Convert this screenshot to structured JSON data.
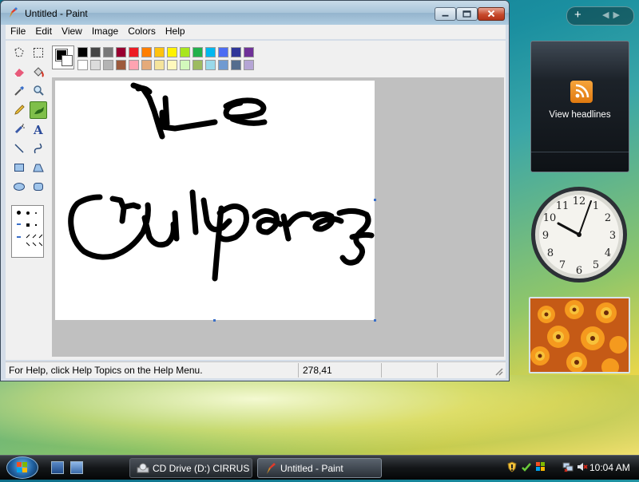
{
  "window": {
    "title": "Untitled - Paint"
  },
  "menu": [
    "File",
    "Edit",
    "View",
    "Image",
    "Colors",
    "Help"
  ],
  "tools": [
    {
      "name": "free-form-select-tool-icon"
    },
    {
      "name": "select-tool-icon"
    },
    {
      "name": "eraser-tool-icon"
    },
    {
      "name": "fill-tool-icon"
    },
    {
      "name": "pick-color-tool-icon"
    },
    {
      "name": "magnifier-tool-icon"
    },
    {
      "name": "pencil-tool-icon"
    },
    {
      "name": "brush-tool-icon",
      "selected": true
    },
    {
      "name": "airbrush-tool-icon"
    },
    {
      "name": "text-tool-icon",
      "glyph": "A"
    },
    {
      "name": "line-tool-icon"
    },
    {
      "name": "curve-tool-icon"
    },
    {
      "name": "rectangle-tool-icon"
    },
    {
      "name": "polygon-tool-icon"
    },
    {
      "name": "ellipse-tool-icon"
    },
    {
      "name": "rounded-rectangle-tool-icon"
    }
  ],
  "palette": {
    "foreground": "#000000",
    "background": "#ffffff",
    "top_row": [
      "#000000",
      "#464646",
      "#787878",
      "#990030",
      "#ed1c24",
      "#ff7e00",
      "#ffc20e",
      "#fff200",
      "#a8e61d",
      "#22b14c",
      "#00b7ef",
      "#4d6df3",
      "#2f3699",
      "#6f3198"
    ],
    "bottom_row": [
      "#ffffff",
      "#dcdcdc",
      "#b4b4b4",
      "#9c5a3c",
      "#ffa3b1",
      "#e5aa7a",
      "#f5e49c",
      "#fff9bd",
      "#d3f9bc",
      "#9dbb61",
      "#99d9ea",
      "#709ad1",
      "#546d8e",
      "#b5a5d5"
    ]
  },
  "status": {
    "help": "For Help, click Help Topics on the Help Menu.",
    "coords": "278,41"
  },
  "gadgets": {
    "feed_label": "View headlines"
  },
  "taskbar": {
    "tasks": [
      {
        "label": "CD Drive (D:) CIRRUS"
      },
      {
        "label": "Untitled - Paint"
      }
    ],
    "time": "10:04 AM"
  },
  "colors": {
    "accent": "#7fbf4a",
    "titlebar": "#a9c5da",
    "close": "#c74a2c"
  }
}
